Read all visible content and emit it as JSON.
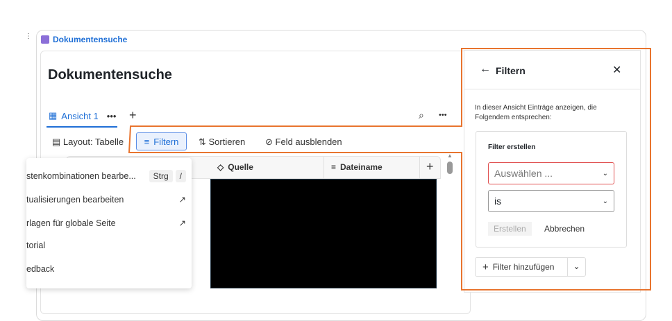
{
  "breadcrumb": {
    "label": "Dokumentensuche"
  },
  "page": {
    "title": "Dokumentensuche"
  },
  "tabs": [
    {
      "label": "Ansicht 1"
    }
  ],
  "toolbar": {
    "layout": "Layout: Tabelle",
    "filter": "Filtern",
    "sort": "Sortieren",
    "hide": "Feld ausblenden"
  },
  "table": {
    "columns": [
      "Quelle",
      "Dateiname"
    ]
  },
  "menu": {
    "items": [
      {
        "label": "stenkombinationen bearbe...",
        "shortcut": [
          "Strg",
          "/"
        ]
      },
      {
        "label": "tualisierungen bearbeiten"
      },
      {
        "label": "rlagen für globale Seite"
      },
      {
        "label": "torial"
      },
      {
        "label": "edback"
      }
    ]
  },
  "filter_panel": {
    "title": "Filtern",
    "description": "In dieser Ansicht Einträge anzeigen, die Folgendem entsprechen:",
    "box_title": "Filter erstellen",
    "field_placeholder": "Auswählen ...",
    "operator": "is",
    "create": "Erstellen",
    "cancel": "Abbrechen",
    "add_filter": "Filter hinzufügen"
  },
  "colors": {
    "accent": "#1f6fd6",
    "annotation": "#e8742e",
    "error": "#e05050"
  }
}
